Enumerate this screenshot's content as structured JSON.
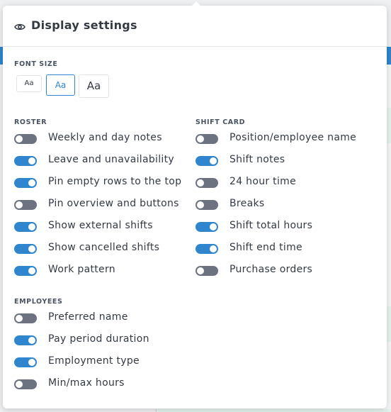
{
  "popup": {
    "title": "Display settings"
  },
  "font_size": {
    "label": "FONT SIZE",
    "options": [
      "Aa",
      "Aa",
      "Aa"
    ],
    "selected_index": 1
  },
  "roster": {
    "label": "ROSTER",
    "items": [
      {
        "label": "Weekly and day notes",
        "on": false
      },
      {
        "label": "Leave and unavailability",
        "on": true
      },
      {
        "label": "Pin empty rows to the top",
        "on": true
      },
      {
        "label": "Pin overview and buttons",
        "on": false
      },
      {
        "label": "Show external shifts",
        "on": true
      },
      {
        "label": "Show cancelled shifts",
        "on": true
      },
      {
        "label": "Work pattern",
        "on": true
      }
    ]
  },
  "shift_card": {
    "label": "SHIFT CARD",
    "items": [
      {
        "label": "Position/employee name",
        "on": false
      },
      {
        "label": "Shift notes",
        "on": true
      },
      {
        "label": "24 hour time",
        "on": false
      },
      {
        "label": "Breaks",
        "on": false
      },
      {
        "label": "Shift total hours",
        "on": true
      },
      {
        "label": "Shift end time",
        "on": true
      },
      {
        "label": "Purchase orders",
        "on": false
      }
    ]
  },
  "employees": {
    "label": "EMPLOYEES",
    "items": [
      {
        "label": "Preferred name",
        "on": false
      },
      {
        "label": "Pay period duration",
        "on": true
      },
      {
        "label": "Employment type",
        "on": true
      },
      {
        "label": "Min/max hours",
        "on": false
      }
    ]
  },
  "colors": {
    "accent": "#2f86cf",
    "toggle_off": "#6d7280",
    "text": "#333a44"
  },
  "icons": {
    "header": "eye-icon"
  }
}
